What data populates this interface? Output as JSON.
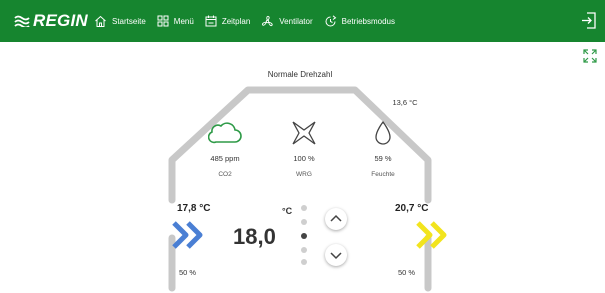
{
  "brand": {
    "name": "REGIN"
  },
  "nav": [
    {
      "label": "Startseite",
      "icon": "home-icon"
    },
    {
      "label": "Menü",
      "icon": "menu-grid-icon"
    },
    {
      "label": "Zeitplan",
      "icon": "calendar-icon"
    },
    {
      "label": "Ventilator",
      "icon": "fan-icon"
    },
    {
      "label": "Betriebsmodus",
      "icon": "operating-mode-icon"
    }
  ],
  "header_icons": {
    "logout": "logout-icon",
    "fullscreen": "fullscreen-icon"
  },
  "house": {
    "mode": "Normale Drehzahl",
    "outdoor_temp": "13,6 °C"
  },
  "sensors": [
    {
      "value": "485 ppm",
      "label": "CO2",
      "icon": "cloud-icon"
    },
    {
      "value": "100 %",
      "label": "WRG",
      "icon": "heat-recovery-icon"
    },
    {
      "value": "59 %",
      "label": "Feuchte",
      "icon": "humidity-drop-icon"
    }
  ],
  "supply": {
    "temp": "17,8 °C",
    "percent": "50 %",
    "color": "#4a7fd4"
  },
  "extract": {
    "temp": "20,7 °C",
    "percent": "50 %",
    "color": "#f2e41e"
  },
  "setpoint": {
    "value": "18,0",
    "unit": "°C"
  },
  "colors": {
    "header": "#16852f",
    "house_outline": "#c8c8c8"
  }
}
